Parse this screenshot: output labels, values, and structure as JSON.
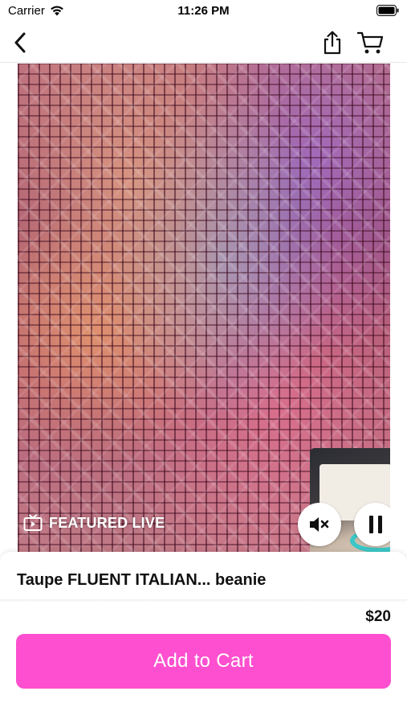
{
  "status_bar": {
    "carrier": "Carrier",
    "time": "11:26 PM",
    "wifi_icon": "wifi-icon",
    "battery_icon": "battery-icon"
  },
  "nav_bar": {
    "back_icon": "chevron-left-icon",
    "share_icon": "share-icon",
    "cart_icon": "cart-icon"
  },
  "video": {
    "badge_icon": "tv-icon",
    "badge_label": "FEATURED LIVE",
    "mute_icon": "speaker-muted-icon",
    "pause_icon": "pause-icon"
  },
  "product": {
    "title": "Taupe FLUENT ITALIAN... beanie",
    "price": "$20",
    "add_to_cart_label": "Add to Cart"
  },
  "colors": {
    "accent": "#fd4fcf",
    "button_text": "#ffffff"
  }
}
